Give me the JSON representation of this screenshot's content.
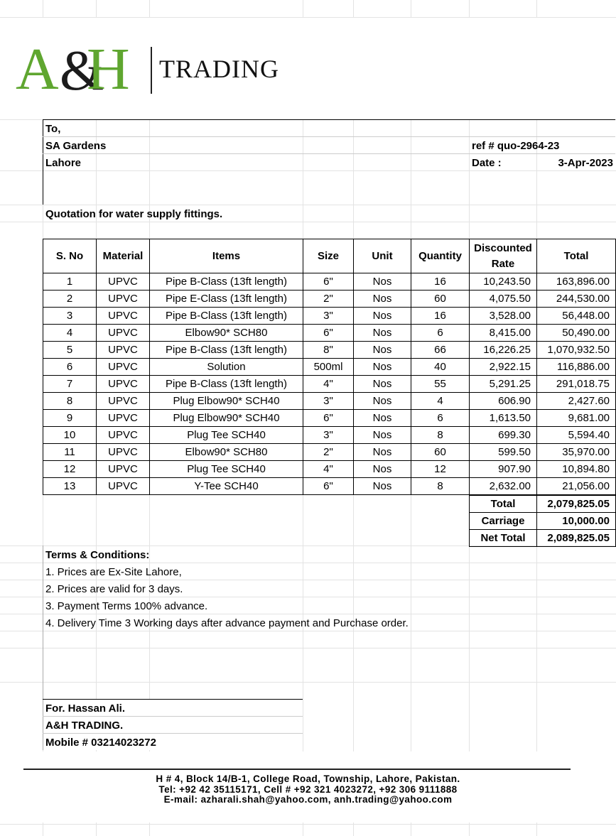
{
  "company": {
    "logo_text": "A&H",
    "wordmark": "TRADING"
  },
  "recipient": {
    "to_label": "To,",
    "name": "SA Gardens",
    "city": "Lahore"
  },
  "reference": {
    "ref": "ref # quo-2964-23",
    "date_label": "Date :",
    "date_value": "3-Apr-2023"
  },
  "subject": "Quotation for water supply fittings.",
  "table": {
    "headers": [
      "S. No",
      "Material",
      "Items",
      "Size",
      "Unit",
      "Quantity",
      "Discounted Rate",
      "Total"
    ],
    "rows": [
      [
        "1",
        "UPVC",
        "Pipe B-Class (13ft length)",
        "6\"",
        "Nos",
        "16",
        "10,243.50",
        "163,896.00"
      ],
      [
        "2",
        "UPVC",
        "Pipe E-Class (13ft length)",
        "2\"",
        "Nos",
        "60",
        "4,075.50",
        "244,530.00"
      ],
      [
        "3",
        "UPVC",
        "Pipe B-Class (13ft length)",
        "3\"",
        "Nos",
        "16",
        "3,528.00",
        "56,448.00"
      ],
      [
        "4",
        "UPVC",
        "Elbow90* SCH80",
        "6\"",
        "Nos",
        "6",
        "8,415.00",
        "50,490.00"
      ],
      [
        "5",
        "UPVC",
        "Pipe B-Class (13ft length)",
        "8\"",
        "Nos",
        "66",
        "16,226.25",
        "1,070,932.50"
      ],
      [
        "6",
        "UPVC",
        "Solution",
        "500ml",
        "Nos",
        "40",
        "2,922.15",
        "116,886.00"
      ],
      [
        "7",
        "UPVC",
        "Pipe B-Class (13ft length)",
        "4\"",
        "Nos",
        "55",
        "5,291.25",
        "291,018.75"
      ],
      [
        "8",
        "UPVC",
        "Plug Elbow90* SCH40",
        "3\"",
        "Nos",
        "4",
        "606.90",
        "2,427.60"
      ],
      [
        "9",
        "UPVC",
        "Plug Elbow90* SCH40",
        "6\"",
        "Nos",
        "6",
        "1,613.50",
        "9,681.00"
      ],
      [
        "10",
        "UPVC",
        "Plug Tee SCH40",
        "3\"",
        "Nos",
        "8",
        "699.30",
        "5,594.40"
      ],
      [
        "11",
        "UPVC",
        "Elbow90* SCH80",
        "2\"",
        "Nos",
        "60",
        "599.50",
        "35,970.00"
      ],
      [
        "12",
        "UPVC",
        "Plug Tee SCH40",
        "4\"",
        "Nos",
        "12",
        "907.90",
        "10,894.80"
      ],
      [
        "13",
        "UPVC",
        "Y-Tee SCH40",
        "6\"",
        "Nos",
        "8",
        "2,632.00",
        "21,056.00"
      ]
    ]
  },
  "totals": {
    "total_label": "Total",
    "total_value": "2,079,825.05",
    "carriage_label": "Carriage",
    "carriage_value": "10,000.00",
    "net_label": "Net Total",
    "net_value": "2,089,825.05"
  },
  "terms": {
    "heading": "Terms & Conditions:",
    "items": [
      "1. Prices are Ex-Site Lahore,",
      "2. Prices are valid for 3 days.",
      "3. Payment Terms 100% advance.",
      "4. Delivery Time 3 Working days after advance payment and Purchase order."
    ]
  },
  "signature": {
    "for_line": "For. Hassan Ali.",
    "company_line": "A&H TRADING.",
    "mobile_line": "Mobile # 03214023272"
  },
  "footer": {
    "address": "H # 4, Block 14/B-1, College Road, Township, Lahore, Pakistan.",
    "phones": "Tel: +92 42 35115171, Cell # +92 321 4023272, +92 306 9111888",
    "email": "E-mail: azharali.shah@yahoo.com, anh.trading@yahoo.com"
  }
}
